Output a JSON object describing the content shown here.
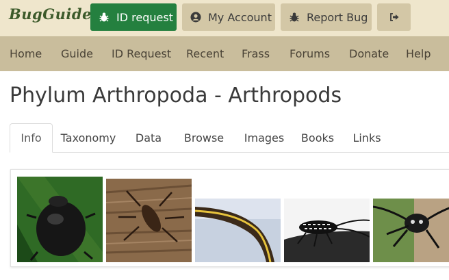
{
  "header": {
    "logo_text": "BugGuide",
    "buttons": [
      {
        "label": "ID request",
        "icon": "bug-icon",
        "color": "#24803f"
      },
      {
        "label": "My Account",
        "icon": "user-circle-icon"
      },
      {
        "label": "Report Bug",
        "icon": "bug-icon"
      },
      {
        "label": "",
        "icon": "sign-out-icon"
      }
    ]
  },
  "nav": {
    "items": [
      "Home",
      "Guide",
      "ID Request",
      "Recent",
      "Frass",
      "Forums",
      "Donate",
      "Help"
    ]
  },
  "page": {
    "title": "Phylum Arthropoda - Arthropods"
  },
  "tabs": [
    {
      "label": "Info",
      "active": true
    },
    {
      "label": "Taxonomy"
    },
    {
      "label": "Data"
    },
    {
      "label": "Browse"
    },
    {
      "label": "Images"
    },
    {
      "label": "Books"
    },
    {
      "label": "Links"
    }
  ],
  "gallery": {
    "images": [
      "beetle-photo",
      "bug-photo",
      "caterpillar-photo",
      "longhorn-beetle-photo",
      "beetle-closeup-photo"
    ]
  },
  "colors": {
    "topbar": "#efe6cc",
    "navbar": "#c9bd9c",
    "primary_button": "#24803f",
    "secondary_button": "#d3c7a6"
  }
}
